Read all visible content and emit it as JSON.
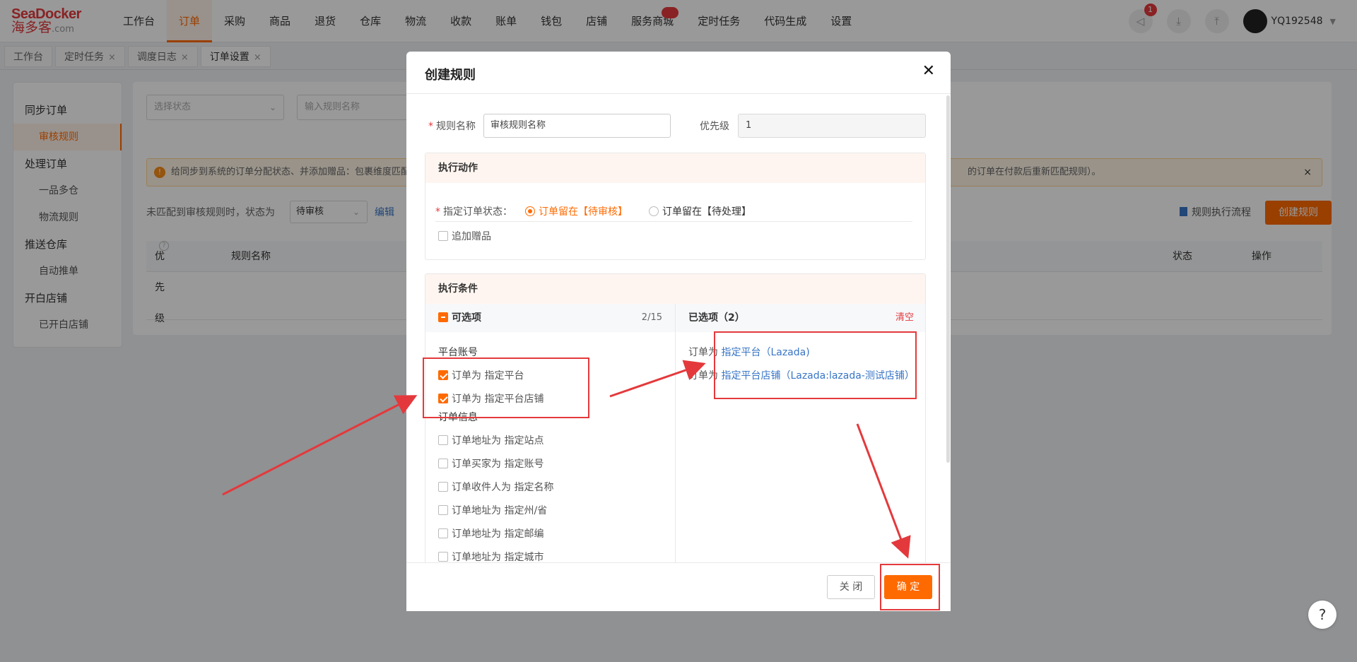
{
  "brand": {
    "line1": "SeaDocker",
    "line2": "海多客",
    "line3": ".com"
  },
  "nav": {
    "items": [
      "工作台",
      "订单",
      "采购",
      "商品",
      "退货",
      "仓库",
      "物流",
      "收款",
      "账单",
      "钱包",
      "店铺",
      "服务商城",
      "定时任务",
      "代码生成",
      "设置"
    ],
    "active_index": 1
  },
  "topright": {
    "notification_count": "1",
    "username": "YQ192548"
  },
  "tabs": [
    {
      "label": "工作台",
      "closable": false
    },
    {
      "label": "定时任务",
      "closable": true
    },
    {
      "label": "调度日志",
      "closable": true
    },
    {
      "label": "订单设置",
      "closable": true,
      "active": true
    }
  ],
  "sidebar": {
    "groups": [
      {
        "label": "同步订单",
        "items": [
          "审核规则"
        ]
      },
      {
        "label": "处理订单",
        "items": [
          "一品多仓",
          "物流规则"
        ]
      },
      {
        "label": "推送仓库",
        "items": [
          "自动推单"
        ]
      },
      {
        "label": "开白店铺",
        "items": [
          "已开白店铺"
        ]
      }
    ],
    "active_item": "审核规则"
  },
  "main": {
    "status_filter_placeholder": "选择状态",
    "rule_name_placeholder": "输入规则名称",
    "notice_text": "给同步到系统的订单分配状态、并添加赠品：包裹维度匹配",
    "notice_text_tail": "的订单在付款后重新匹配规则）。",
    "unmatched_label": "未匹配到审核规则时，状态为",
    "unmatched_status": "待审核",
    "edit_label": "编辑",
    "flow_label": "规则执行流程",
    "create_label": "创建规则",
    "columns": {
      "priority": "优先级",
      "rule_name": "规则名称",
      "status": "状态",
      "action": "操作"
    }
  },
  "modal": {
    "title": "创建规则",
    "rule_name_label": "规则名称",
    "rule_name_value": "审核规则名称",
    "priority_label": "优先级",
    "priority_value": "1",
    "action_section": "执行动作",
    "order_state_label": "指定订单状态：",
    "radio_options": [
      "订单留在【待审核】",
      "订单留在【待处理】"
    ],
    "radio_selected": 0,
    "add_gift_label": "追加赠品",
    "condition_section": "执行条件",
    "available_header": "可选项",
    "available_count": "2/15",
    "selected_header": "已选项（2）",
    "clear_label": "清空",
    "groups": [
      {
        "label": "平台账号",
        "options": [
          {
            "label": "订单为 指定平台",
            "checked": true
          },
          {
            "label": "订单为 指定平台店铺",
            "checked": true
          }
        ]
      },
      {
        "label": "订单信息",
        "options": [
          {
            "label": "订单地址为 指定站点",
            "checked": false
          },
          {
            "label": "订单买家为 指定账号",
            "checked": false
          },
          {
            "label": "订单收件人为 指定名称",
            "checked": false
          },
          {
            "label": "订单地址为 指定州/省",
            "checked": false
          },
          {
            "label": "订单地址为 指定邮编",
            "checked": false
          },
          {
            "label": "订单地址为 指定城市",
            "checked": false
          }
        ]
      }
    ],
    "selected_items": [
      {
        "prefix": "订单为 ",
        "link": "指定平台（Lazada)"
      },
      {
        "prefix": "订单为 ",
        "link": "指定平台店铺（Lazada:lazada-测试店铺）"
      }
    ],
    "close_label": "关 闭",
    "ok_label": "确 定"
  },
  "help_label": "?"
}
